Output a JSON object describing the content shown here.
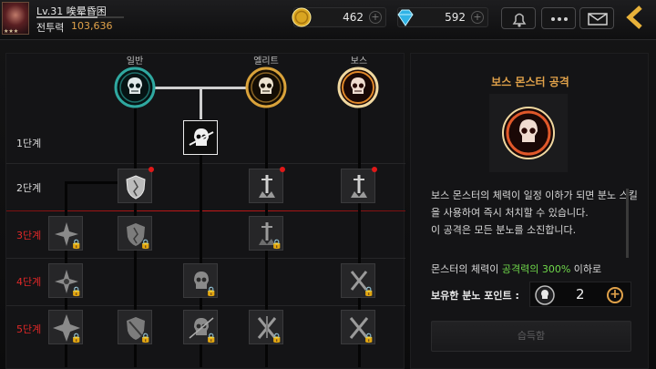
{
  "player": {
    "level": "Lv.31",
    "name": "唉晕昏困",
    "power_label": "전투력",
    "power_value": "103,636",
    "exp_fraction": 0.7
  },
  "currency": {
    "gold": "462",
    "gems": "592"
  },
  "tree": {
    "columns": [
      "일반",
      "엘리트",
      "보스"
    ],
    "tiers": [
      "1단계",
      "2단계",
      "3단계",
      "4단계",
      "5단계"
    ],
    "tier_colors": [
      "#d8d8d8",
      "#d8d8d8",
      "#e02828",
      "#e02828",
      "#e02828"
    ]
  },
  "info": {
    "title": "보스 몬스터 공격",
    "description": "보스 몬스터의 체력이 일정 이하가 되면 분노 스킬을 사용하여 즉시 처치할 수 있습니다.\n 이 공격은 모든 분노를 소진합니다.",
    "condition_prefix": "몬스터의 체력이 ",
    "condition_highlight": "공격력의 300%",
    "condition_suffix": " 이하로",
    "points_label": "보유한 분노 포인트 :",
    "points_value": "2",
    "learn_button": "습득함"
  },
  "colors": {
    "accent": "#e1a24a",
    "highlight": "#6fd84a",
    "locked_tier": "#e02828",
    "ring_normal": "#2fa8a0",
    "ring_elite": "#d9a23a",
    "ring_boss": "#e0882a"
  },
  "icons": [
    "gold-coin-icon",
    "gem-icon",
    "bell-icon",
    "more-icon",
    "mail-icon",
    "back-arrow-icon",
    "skull-icon",
    "shield-icon",
    "sword-icon",
    "lock-icon",
    "plus-icon"
  ]
}
